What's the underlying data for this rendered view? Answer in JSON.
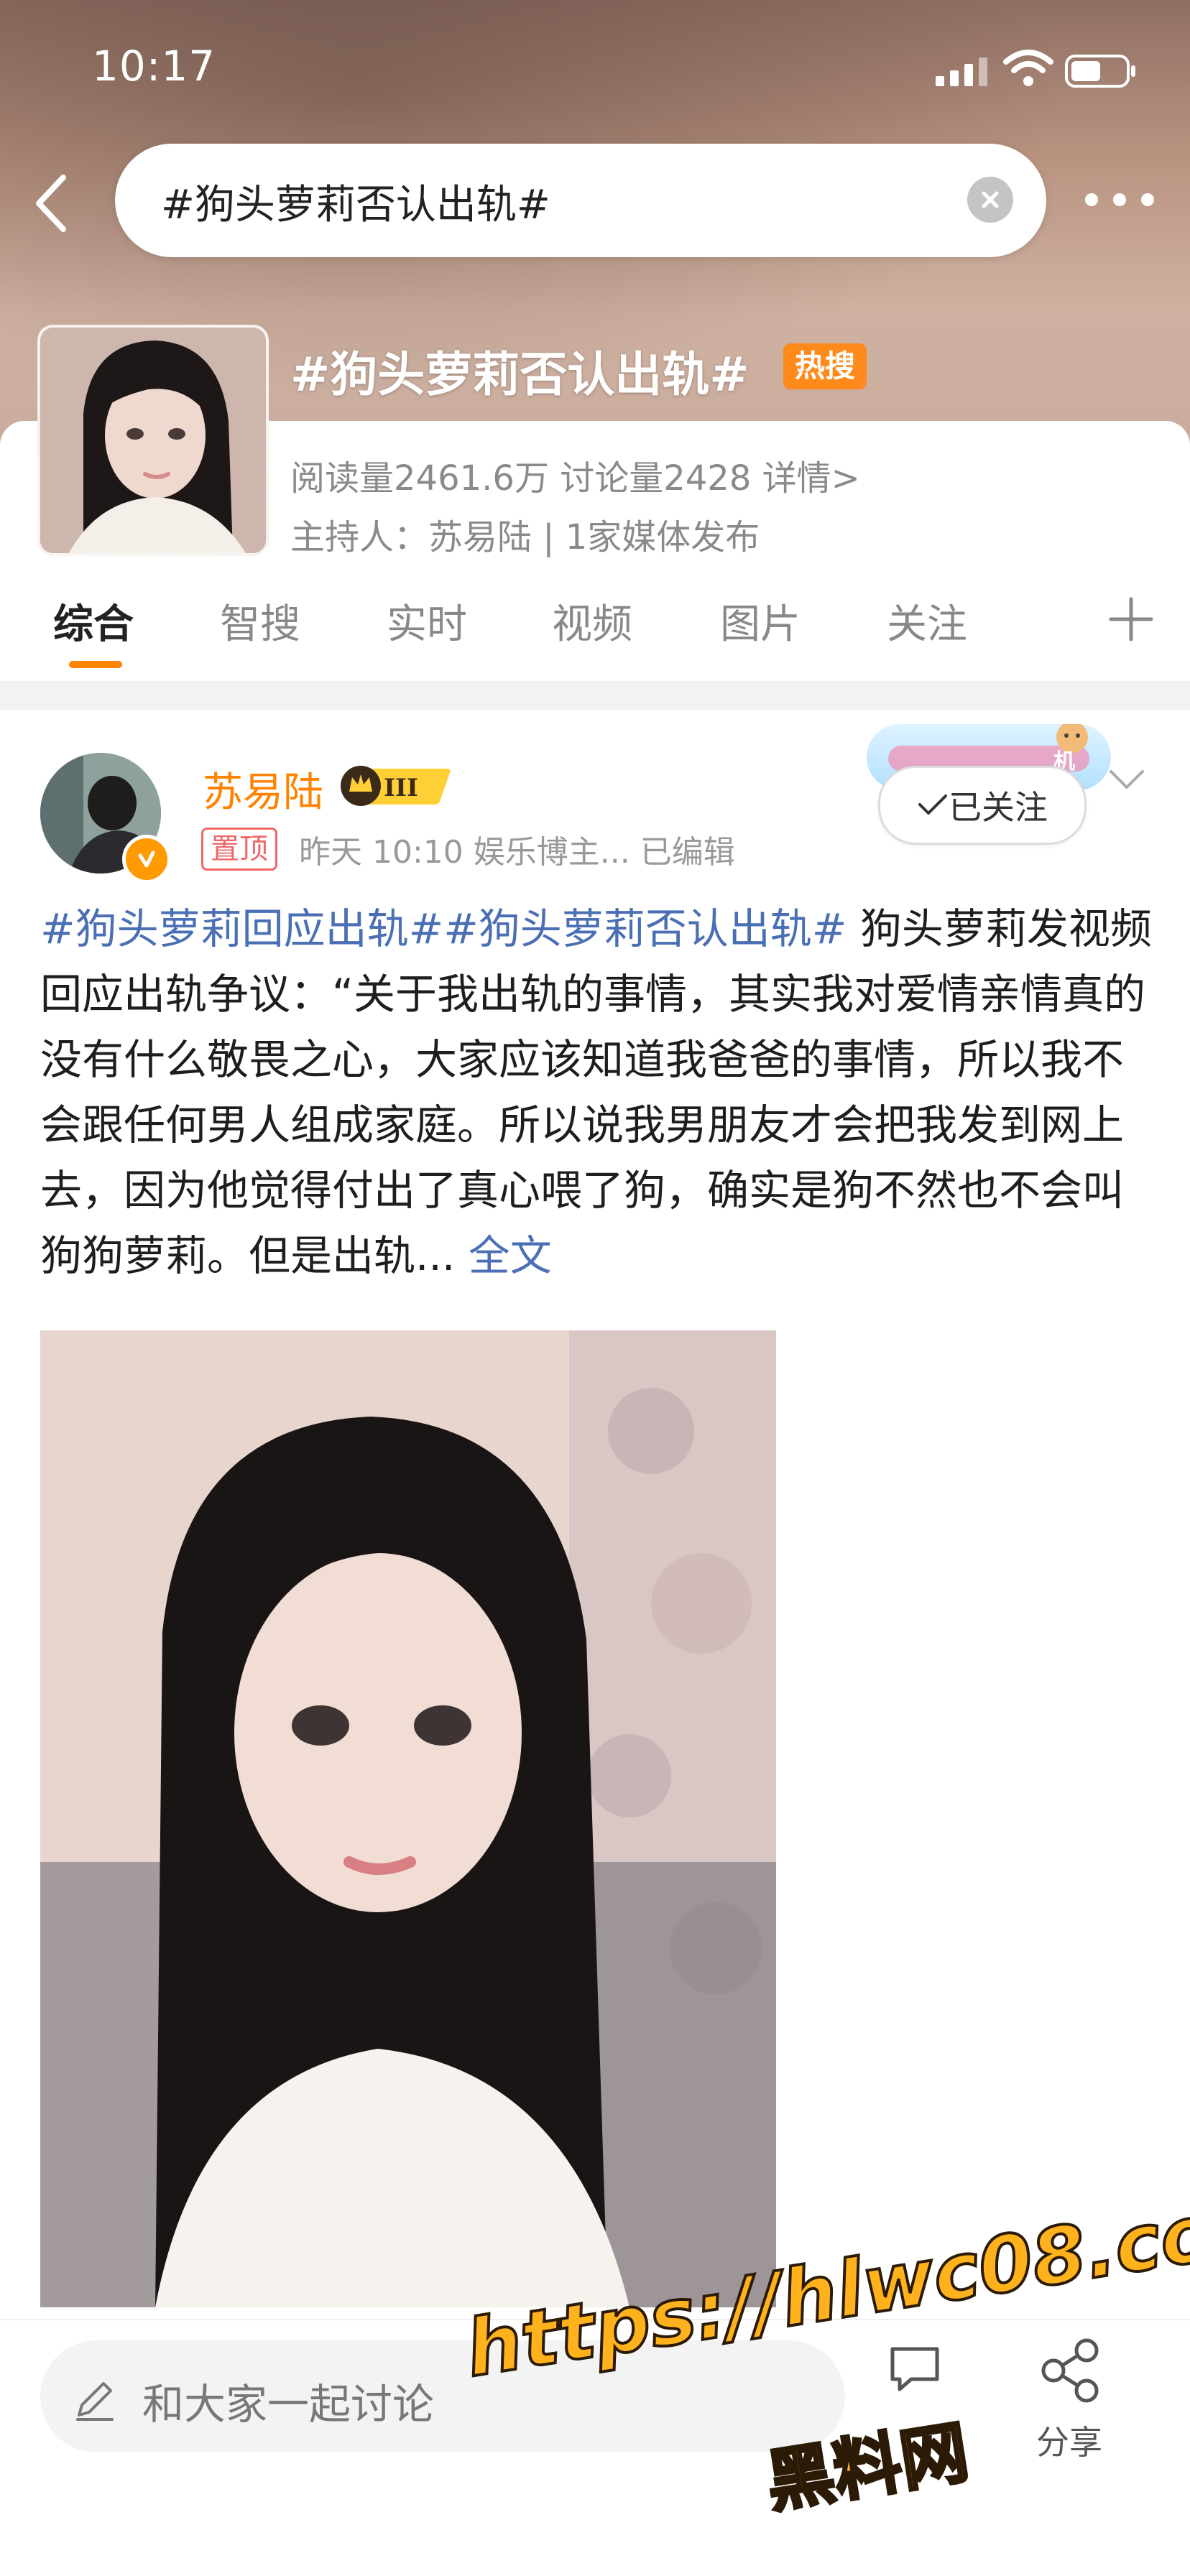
{
  "status_bar": {
    "time": "10:17"
  },
  "search": {
    "query": "#狗头萝莉否认出轨#"
  },
  "topic": {
    "title": "#狗头萝莉否认出轨#",
    "hot_badge": "热搜",
    "stats": "阅读量2461.6万   讨论量2428   详情>",
    "host": "主持人：苏易陆 | 1家媒体发布"
  },
  "tabs": [
    "综合",
    "智搜",
    "实时",
    "视频",
    "图片",
    "关注"
  ],
  "post": {
    "author": "苏易陆",
    "crown_level": "III",
    "pinned": "置顶",
    "meta": "昨天 10:10  娱乐博主...  已编辑",
    "follow_label": "已关注",
    "banner_text": "机",
    "topics": "#狗头萝莉回应出轨##狗头萝莉否认出轨#",
    "body": " 狗头萝莉发视频回应出轨争议：“关于我出轨的事情，其实我对爱情亲情真的没有什么敬畏之心，大家应该知道我爸爸的事情，所以我不会跟任何男人组成家庭。所以说我男朋友才会把我发到网上去，因为他觉得付出了真心喂了狗，确实是狗不然也不会叫狗狗萝莉。但是出轨...",
    "full_text_link": "全文"
  },
  "bottom_bar": {
    "comment_placeholder": "和大家一起讨论",
    "share_label": "分享"
  },
  "watermark": {
    "url": "https://hlwc08.com",
    "name": "黑料网"
  },
  "colors": {
    "accent": "#ff8200",
    "topic_link": "#4a6fb4",
    "hot_badge": "#ff8a1c"
  }
}
